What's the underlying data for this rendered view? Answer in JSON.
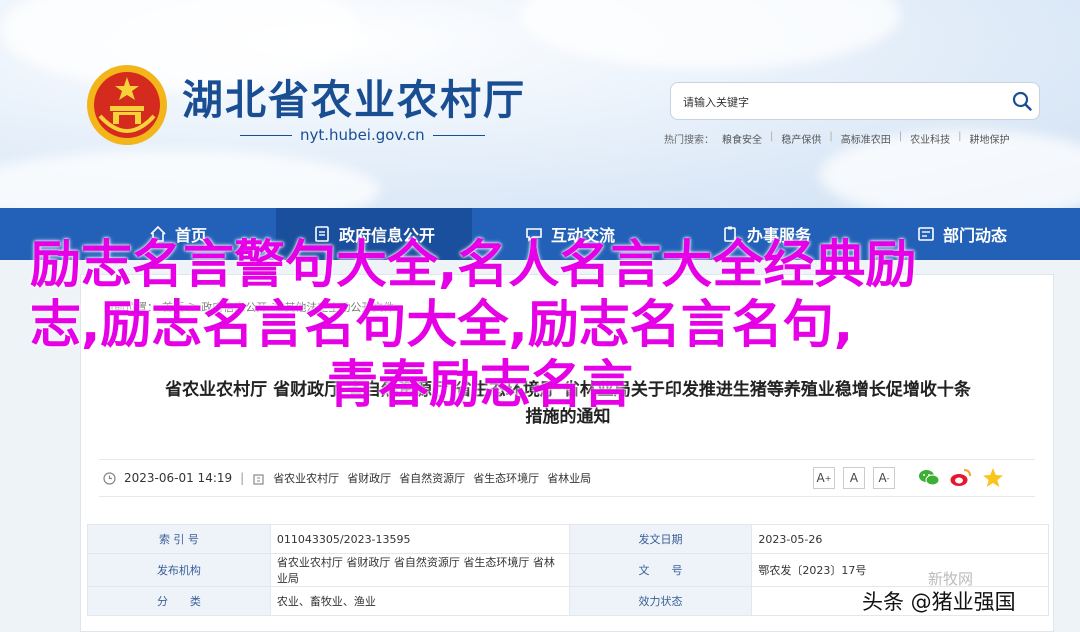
{
  "header": {
    "site_title": "湖北省农业农村厅",
    "site_url": "nyt.hubei.gov.cn",
    "search_placeholder": "请输入关键字",
    "hot_label": "热门搜索：",
    "hot_links": [
      "粮食安全",
      "稳产保供",
      "高标准农田",
      "农业科技",
      "耕地保护"
    ]
  },
  "nav": {
    "items": [
      "首页",
      "政府信息公开",
      "互动交流",
      "办事服务",
      "部门动态"
    ],
    "active_index": 1
  },
  "breadcrumb": [
    "当前位置：",
    "首页",
    ">",
    "政府信息公开",
    ">",
    "其他法定主动公开文件"
  ],
  "article": {
    "title_line1": "省农业农村厅 省财政厅 省自然资源厅 省生态环境厅 省林业局关于印发推进生猪等养殖业稳增长促增收十条",
    "title_line2": "措施的通知",
    "date": "2023-06-01 14:19",
    "orgs": [
      "省农业农村厅",
      "省财政厅",
      "省自然资源厅",
      "省生态环境厅",
      "省林业局"
    ],
    "font_buttons": [
      "A",
      "A",
      "A"
    ],
    "font_button_marks": [
      "+",
      "",
      "-"
    ]
  },
  "info_table": {
    "rows": [
      [
        "索 引 号",
        "011043305/2023-13595",
        "发文日期",
        "2023-05-26"
      ],
      [
        "发布机构",
        "省农业农村厅 省财政厅 省自然资源厅 省生态环境厅 省林业局",
        "文　　号",
        "鄂农发〔2023〕17号"
      ],
      [
        "分　　类",
        "农业、畜牧业、渔业",
        "效力状态",
        ""
      ]
    ]
  },
  "overlay": {
    "line1": "励志名言警句大全,名人名言大全经典励",
    "line2": "志,励志名言名句大全,励志名言名句,",
    "line3": "青春励志名言"
  },
  "watermark": {
    "text": "头条 @猪业强国",
    "faint": "新牧网"
  },
  "colors": {
    "brand_blue": "#1a4e93",
    "nav_blue": "#2261b7",
    "overlay_magenta": "#e600e6"
  }
}
